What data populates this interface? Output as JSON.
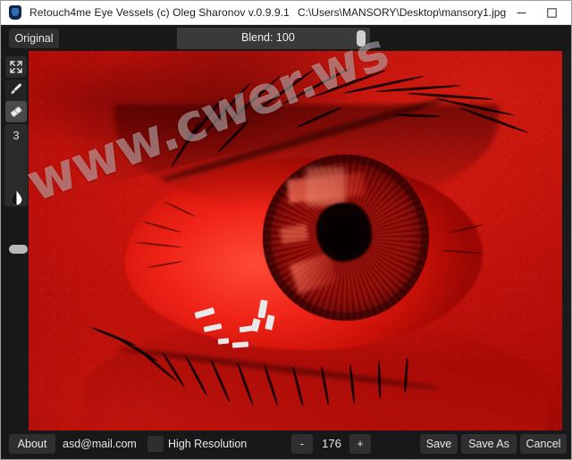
{
  "window": {
    "app_icon": "app-shield-icon",
    "title": "Retouch4me Eye Vessels (c) Oleg Sharonov v.0.9.9.1",
    "file_path": "C:\\Users\\MANSORY\\Desktop\\mansory1.jpg",
    "minimize_icon": "minimize-icon",
    "maximize_icon": "maximize-icon",
    "close_icon": "close-icon"
  },
  "toolbar": {
    "original_label": "Original",
    "blend_label": "Blend: 100",
    "blend_value": 100
  },
  "tools": {
    "expand_icon": "expand-fullscreen-icon",
    "brush_icon": "brush-icon",
    "eraser_icon": "eraser-icon",
    "brush_size": "3",
    "contrast_icon": "contrast-droplet-icon",
    "selected": "eraser"
  },
  "canvas": {
    "watermark": "www.cwer.ws",
    "image_subject": "close-up-red-eye-photo"
  },
  "statusbar": {
    "about_label": "About",
    "email": "asd@mail.com",
    "high_resolution_label": "High Resolution",
    "high_resolution_checked": false,
    "zoom_minus_label": "-",
    "zoom_value": "176",
    "zoom_plus_label": "+",
    "save_label": "Save",
    "save_as_label": "Save As",
    "cancel_label": "Cancel"
  },
  "colors": {
    "chrome_dark": "#181818",
    "button_face": "#2f2f2f",
    "titlebar": "#ffffff",
    "image_red": "#c21009",
    "accent_handle": "#cfcfcf"
  }
}
